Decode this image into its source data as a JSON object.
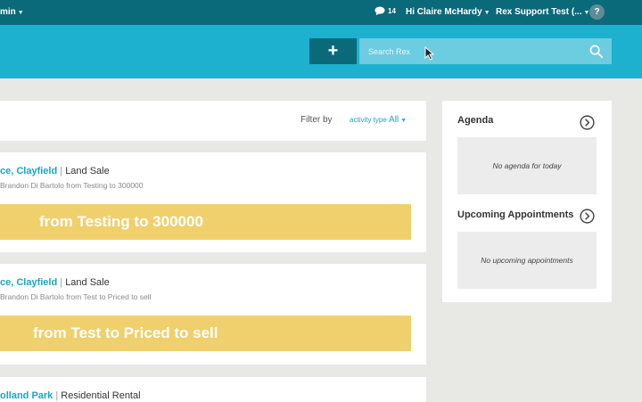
{
  "topnav": {
    "admin_label": "min",
    "messages_count": "14",
    "user_greeting": "Hi Claire McHardy",
    "account_label": "Rex Support Test (...",
    "help_label": "?"
  },
  "header": {
    "add_label": "+",
    "search_placeholder": "Search Rex"
  },
  "feed": {
    "filter_label": "Filter by",
    "filter_type_label": "activity type",
    "filter_value": "All",
    "items": [
      {
        "location": "ce, Clayfield",
        "category": "Land Sale",
        "subtitle": "Brandon Di Bartolo from Testing to 300000",
        "banner": "from Testing to 300000"
      },
      {
        "location": "ce, Clayfield",
        "category": "Land Sale",
        "subtitle": "Brandon Di Bartolo from Test to Priced to sell",
        "banner": "from Test to Priced to sell"
      },
      {
        "location": "olland Park",
        "category": "Residential Rental"
      }
    ]
  },
  "sidebar": {
    "agenda_title": "Agenda",
    "agenda_empty": "No agenda for today",
    "appointments_title": "Upcoming Appointments",
    "appointments_empty": "No upcoming appointments"
  },
  "colors": {
    "topnav": "#0a6a7a",
    "header": "#1db1cf",
    "search_bg": "#6ccce0",
    "link": "#1aa5c4",
    "banner": "#f0d06c",
    "page_bg": "#e8e8e4"
  },
  "icons": {
    "messages": "speech-bubble-icon",
    "search": "magnifier-icon",
    "section_arrow": "circle-chevron-right-icon"
  }
}
